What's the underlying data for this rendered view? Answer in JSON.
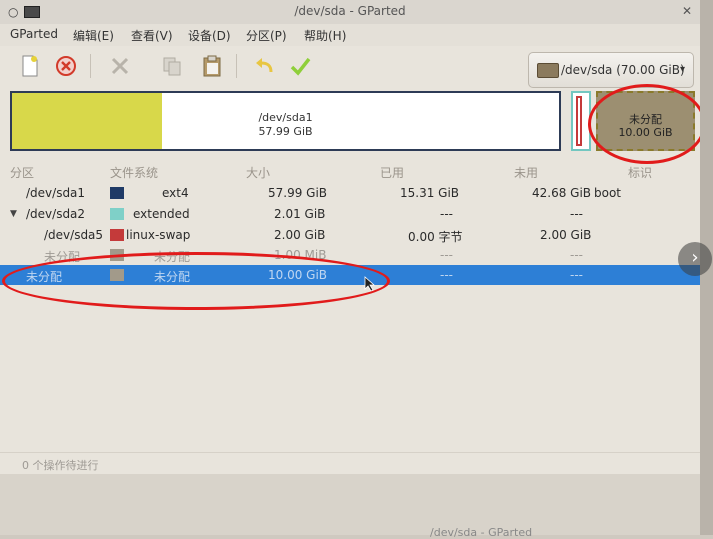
{
  "window": {
    "title": "/dev/sda - GParted",
    "controls": [
      "○",
      "✕"
    ]
  },
  "menubar": {
    "items": [
      "GParted",
      "编辑(E)",
      "查看(V)",
      "设备(D)",
      "分区(P)",
      "帮助(H)"
    ]
  },
  "toolbar": {
    "icons": [
      "new-icon",
      "delete-icon",
      "resize-move-icon",
      "copy-icon",
      "paste-icon",
      "undo-icon",
      "apply-icon"
    ]
  },
  "device_selector": {
    "label": "/dev/sda (70.00 GiB)",
    "arrow": "▾"
  },
  "diskmap": {
    "sda1_name": "/dev/sda1",
    "sda1_size": "57.99 GiB",
    "unalloc_name": "未分配",
    "unalloc_size": "10.00 GiB"
  },
  "table": {
    "headers": [
      "分区",
      "文件系统",
      "大小",
      "已用",
      "未用",
      "标识"
    ],
    "rows": [
      {
        "partition": "/dev/sda1",
        "swatch": "#1f3a66",
        "filesystem": "ext4",
        "size": "57.99 GiB",
        "used": "15.31 GiB",
        "unused": "42.68 GiB",
        "flags": "boot"
      },
      {
        "partition": "/dev/sda2",
        "swatch": "#7fd0c8",
        "filesystem": "extended",
        "size": "2.01 GiB",
        "used": "---",
        "unused": "---",
        "flags": ""
      },
      {
        "partition": "/dev/sda5",
        "swatch": "#c43a3a",
        "filesystem": "linux-swap",
        "size": "2.00 GiB",
        "used": "0.00 字节",
        "unused": "2.00 GiB",
        "flags": ""
      },
      {
        "partition": "未分配",
        "swatch": "#a29a8a",
        "filesystem": "未分配",
        "size": "1.00 MiB",
        "used": "---",
        "unused": "---",
        "flags": ""
      },
      {
        "partition": "未分配",
        "swatch": "#a29a8a",
        "filesystem": "未分配",
        "size": "10.00 GiB",
        "used": "---",
        "unused": "---",
        "flags": ""
      }
    ]
  },
  "status": {
    "text": "0 个操作待进行"
  },
  "taskbar": {
    "text": "/dev/sda - GParted"
  },
  "colors": {
    "selection": "#2d7fd6",
    "annotation": "#e11b1b"
  },
  "nav": {
    "next": "›"
  }
}
